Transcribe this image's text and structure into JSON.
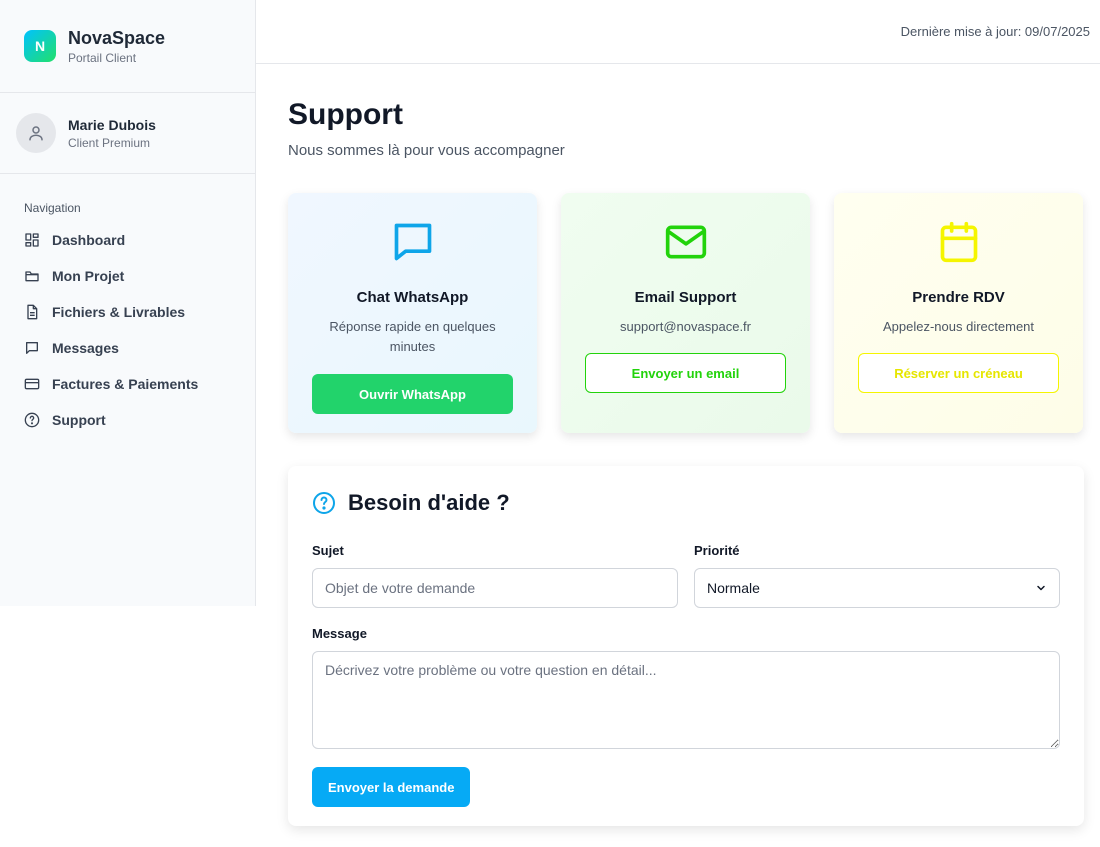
{
  "brand": {
    "logo_letter": "N",
    "name": "NovaSpace",
    "subtitle": "Portail Client"
  },
  "user": {
    "name": "Marie Dubois",
    "role": "Client Premium"
  },
  "nav": {
    "title": "Navigation",
    "items": [
      {
        "label": "Dashboard",
        "icon": "dashboard-icon"
      },
      {
        "label": "Mon Projet",
        "icon": "folder-icon"
      },
      {
        "label": "Fichiers & Livrables",
        "icon": "file-icon"
      },
      {
        "label": "Messages",
        "icon": "message-icon"
      },
      {
        "label": "Factures & Paiements",
        "icon": "credit-card-icon"
      },
      {
        "label": "Support",
        "icon": "help-circle-icon"
      }
    ]
  },
  "topbar": {
    "last_update": "Dernière mise à jour: 09/07/2025"
  },
  "page": {
    "title": "Support",
    "subtitle": "Nous sommes là pour vous accompagner"
  },
  "cards": [
    {
      "title": "Chat WhatsApp",
      "desc": "Réponse rapide en quelques minutes",
      "button": "Ouvrir WhatsApp",
      "icon": "chat-icon",
      "color": "#0ea5e9"
    },
    {
      "title": "Email Support",
      "desc": "support@novaspace.fr",
      "button": "Envoyer un email",
      "icon": "mail-icon",
      "color": "#22d30b"
    },
    {
      "title": "Prendre RDV",
      "desc": "Appelez-nous directement",
      "button": "Réserver un créneau",
      "icon": "calendar-icon",
      "color": "#f5f500"
    }
  ],
  "form": {
    "title": "Besoin d'aide ?",
    "subject_label": "Sujet",
    "subject_placeholder": "Objet de votre demande",
    "priority_label": "Priorité",
    "priority_value": "Normale",
    "message_label": "Message",
    "message_placeholder": "Décrivez votre problème ou votre question en détail...",
    "submit": "Envoyer la demande"
  },
  "colors": {
    "accent": "#06aaf5",
    "whatsapp": "#22d36b",
    "email": "#22d30b",
    "rdv": "#f5f500"
  }
}
